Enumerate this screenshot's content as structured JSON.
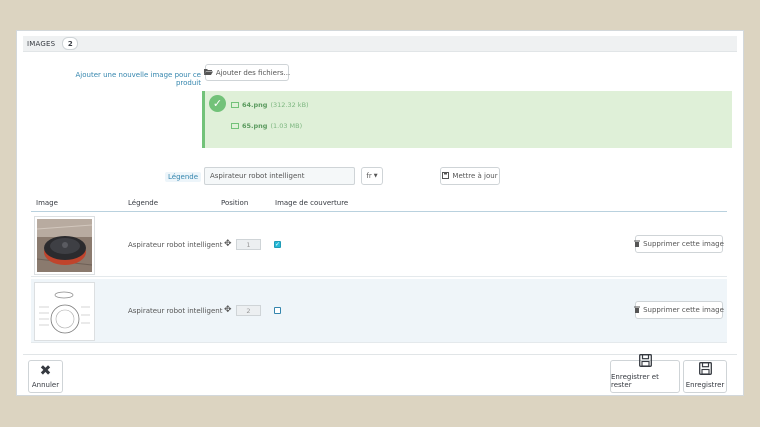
{
  "panel": {
    "title": "IMAGES",
    "count": "2"
  },
  "upload": {
    "label": "Ajouter une nouvelle image pour ce produit",
    "button_label": "Ajouter des fichiers...",
    "files": [
      {
        "name": "64.png",
        "size": "(312.32 kB)"
      },
      {
        "name": "65.png",
        "size": "(1.03 MB)"
      }
    ]
  },
  "legend": {
    "label": "Légende",
    "value": "Aspirateur robot intelligent",
    "lang": "fr",
    "update_button": "Mettre à jour"
  },
  "table": {
    "headers": [
      "Image",
      "Légende",
      "Position",
      "Image de couverture"
    ],
    "rows": [
      {
        "caption": "Aspirateur robot intelligent",
        "position": "1",
        "cover": true,
        "delete_label": "Supprimer cette image"
      },
      {
        "caption": "Aspirateur robot intelligent",
        "position": "2",
        "cover": false,
        "delete_label": "Supprimer cette image"
      }
    ]
  },
  "footer": {
    "cancel_label": "Annuler",
    "save_stay_label": "Enregistrer et rester",
    "save_label": "Enregistrer"
  },
  "colors": {
    "accent": "#25b9d7",
    "link": "#3586ae",
    "success": "#72c279",
    "success_bg": "#dff0d8",
    "page_bg": "#dcd4c1"
  }
}
